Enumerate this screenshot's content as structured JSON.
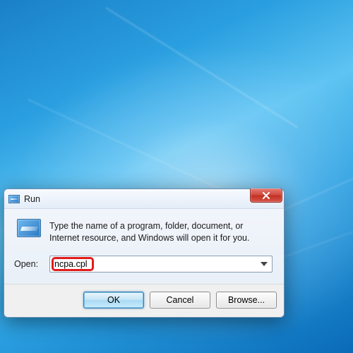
{
  "dialog": {
    "title": "Run",
    "instruction": "Type the name of a program, folder, document, or Internet resource, and Windows will open it for you.",
    "open_label": "Open:",
    "open_value": "ncpa.cpl",
    "buttons": {
      "ok": "OK",
      "cancel": "Cancel",
      "browse": "Browse..."
    }
  },
  "icons": {
    "app_small": "run-prompt-icon",
    "app_large": "run-prompt-icon",
    "close": "close-icon",
    "dropdown": "chevron-down-icon"
  }
}
